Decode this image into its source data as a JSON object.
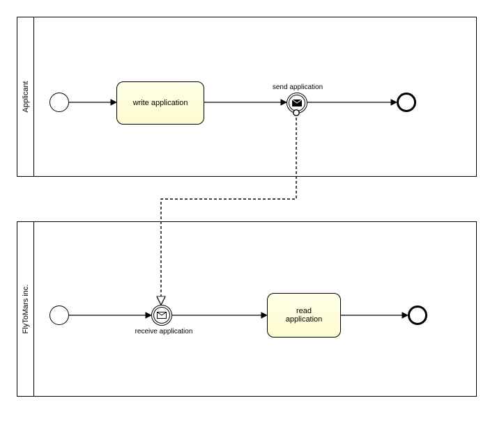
{
  "pools": {
    "applicant": {
      "label": "Applicant"
    },
    "flytomars": {
      "label": "FlyToMars inc."
    }
  },
  "applicant": {
    "task_write": "write application",
    "event_send_label": "send application"
  },
  "flytomars": {
    "event_receive_label": "receive application",
    "task_read": "read\napplication"
  },
  "chart_data": {
    "type": "bpmn",
    "pools": [
      {
        "name": "Applicant",
        "elements": [
          {
            "id": "a_start",
            "type": "startEvent"
          },
          {
            "id": "a_task1",
            "type": "task",
            "name": "write application"
          },
          {
            "id": "a_send",
            "type": "intermediateThrowEvent",
            "event": "message",
            "name": "send application"
          },
          {
            "id": "a_end",
            "type": "endEvent"
          }
        ],
        "sequenceFlows": [
          [
            "a_start",
            "a_task1"
          ],
          [
            "a_task1",
            "a_send"
          ],
          [
            "a_send",
            "a_end"
          ]
        ]
      },
      {
        "name": "FlyToMars inc.",
        "elements": [
          {
            "id": "f_start",
            "type": "startEvent"
          },
          {
            "id": "f_recv",
            "type": "intermediateCatchEvent",
            "event": "message",
            "name": "receive application"
          },
          {
            "id": "f_task1",
            "type": "task",
            "name": "read application"
          },
          {
            "id": "f_end",
            "type": "endEvent"
          }
        ],
        "sequenceFlows": [
          [
            "f_start",
            "f_recv"
          ],
          [
            "f_recv",
            "f_task1"
          ],
          [
            "f_task1",
            "f_end"
          ]
        ]
      }
    ],
    "messageFlows": [
      {
        "from": "a_send",
        "to": "f_recv"
      }
    ]
  }
}
